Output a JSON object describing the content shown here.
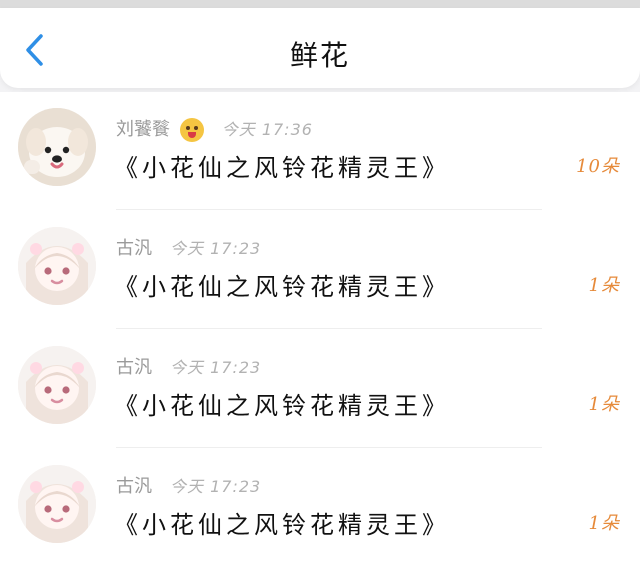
{
  "header": {
    "title": "鲜花",
    "back_icon": "chevron-left-icon"
  },
  "colors": {
    "accent_blue": "#2f8fe6",
    "count_orange": "#e68a3a",
    "meta_gray": "#9a9a9a",
    "time_gray": "#b2b2b2",
    "text_black": "#111111"
  },
  "rows": [
    {
      "name": "刘饕餮",
      "emoji": "yum-face-emoji",
      "time": "今天 17:36",
      "message": "《小花仙之风铃花精灵王》",
      "count": "10朵",
      "avatar": "white-dog-avatar"
    },
    {
      "name": "古汎",
      "time": "今天 17:23",
      "message": "《小花仙之风铃花精灵王》",
      "count": "1朵",
      "avatar": "anime-girl-avatar"
    },
    {
      "name": "古汎",
      "time": "今天 17:23",
      "message": "《小花仙之风铃花精灵王》",
      "count": "1朵",
      "avatar": "anime-girl-avatar"
    },
    {
      "name": "古汎",
      "time": "今天 17:23",
      "message": "《小花仙之风铃花精灵王》",
      "count": "1朵",
      "avatar": "anime-girl-avatar"
    }
  ]
}
